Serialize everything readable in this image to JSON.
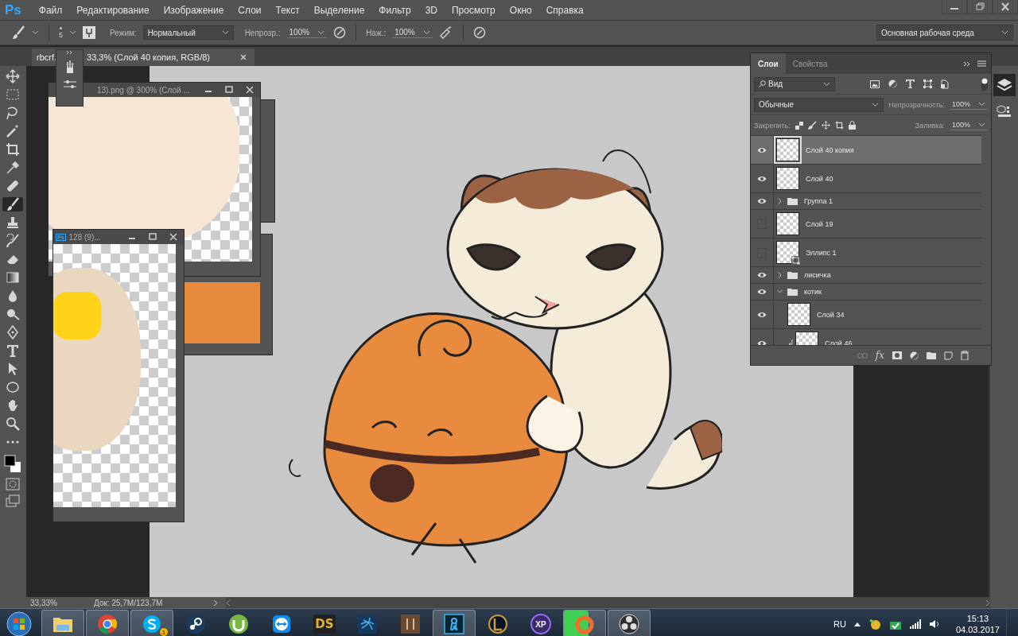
{
  "app_logo": "Ps",
  "menu": [
    "Файл",
    "Редактирование",
    "Изображение",
    "Слои",
    "Текст",
    "Выделение",
    "Фильтр",
    "3D",
    "Просмотр",
    "Окно",
    "Справка"
  ],
  "options_bar": {
    "brush_size": "5",
    "mode_label": "Режим:",
    "mode_value": "Нормальный",
    "opacity_label": "Непрозр.:",
    "opacity_value": "100%",
    "flow_label": "Наж.:",
    "flow_value": "100%",
    "workspace": "Основная рабочая среда"
  },
  "document_tab": {
    "title_start": "rbcrf.",
    "title_end": "33,3% (Слой 40 копия, RGB/8)"
  },
  "tools": [
    {
      "selected": false
    },
    {
      "selected": false
    },
    {
      "selected": false
    },
    {
      "selected": false
    },
    {
      "selected": false
    },
    {
      "selected": false
    },
    {
      "selected": false
    },
    {
      "selected": true
    },
    {
      "selected": false
    },
    {
      "selected": false
    },
    {
      "selected": false
    },
    {
      "selected": false
    },
    {
      "selected": false
    },
    {
      "selected": false
    },
    {
      "selected": false
    },
    {
      "selected": false
    },
    {
      "selected": false
    },
    {
      "selected": false
    },
    {
      "selected": false
    },
    {
      "selected": false
    },
    {
      "selected": false
    }
  ],
  "doc_windows": [
    {
      "title": "13).png @ 300% (Слой ..."
    },
    {
      "badge": "Ps",
      "title": "128 (9)..."
    }
  ],
  "layers_panel": {
    "tabs": [
      {
        "label": "Слои",
        "selected": true
      },
      {
        "label": "Свойства",
        "selected": false
      }
    ],
    "filter": "Вид",
    "blend_mode": "Обычные",
    "opacity_label": "Непрозрачность:",
    "opacity_value": "100%",
    "lock_label": "Закрепить:",
    "fill_label": "Заливка:",
    "fill_value": "100%",
    "fx_label": "fx",
    "layers": [
      {
        "name": "Слой 40 копия",
        "kind": "layer",
        "visible": true,
        "selected": true
      },
      {
        "name": "Слой 40",
        "kind": "layer",
        "visible": true,
        "selected": false
      },
      {
        "name": "Группа 1",
        "kind": "group",
        "visible": true,
        "selected": false,
        "expanded": false
      },
      {
        "name": "Слой 19",
        "kind": "layer",
        "visible": false,
        "selected": false
      },
      {
        "name": "Эллипс 1",
        "kind": "shape",
        "visible": false,
        "selected": false
      },
      {
        "name": "лисичка",
        "kind": "group",
        "visible": true,
        "selected": false,
        "expanded": false
      },
      {
        "name": "котик",
        "kind": "group",
        "visible": true,
        "selected": false,
        "expanded": true,
        "children": [
          {
            "name": "Слой 34",
            "kind": "layer",
            "visible": true,
            "selected": false
          },
          {
            "name": "Слой 46",
            "kind": "clipped",
            "visible": true,
            "selected": false
          }
        ]
      }
    ]
  },
  "status_bar": {
    "zoom": "33,33%",
    "doc_size": "Док: 25,7M/123,7M"
  },
  "taskbar": {
    "apps": [
      {
        "kind": "explorer",
        "open": true
      },
      {
        "kind": "chrome",
        "open": true
      },
      {
        "kind": "skype",
        "open": true,
        "badge": "1"
      },
      {
        "kind": "steam",
        "open": false
      },
      {
        "kind": "utorrent",
        "open": false
      },
      {
        "kind": "teamviewer",
        "open": false
      },
      {
        "kind": "ds",
        "open": false,
        "label": "DS"
      },
      {
        "kind": "launcher",
        "open": false
      },
      {
        "kind": "game",
        "open": false
      },
      {
        "kind": "photoshop",
        "open": true
      },
      {
        "kind": "league",
        "open": false
      },
      {
        "kind": "xp",
        "open": false,
        "label": "XP"
      },
      {
        "kind": "origin",
        "open": true,
        "level": 0.6
      },
      {
        "kind": "obs",
        "open": true
      }
    ],
    "language": "RU",
    "time": "15:13",
    "date": "04.03.2017"
  }
}
